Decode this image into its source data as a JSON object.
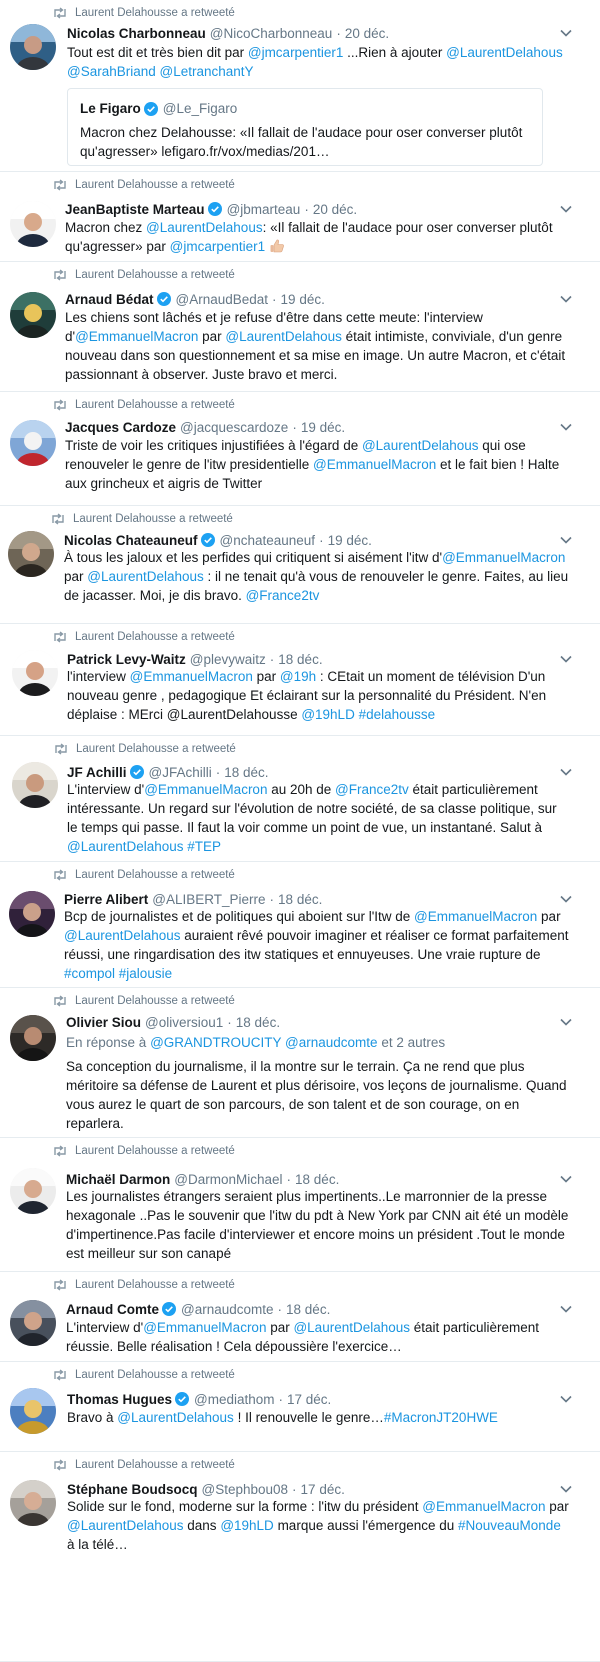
{
  "retweet_label": "Laurent Delahousse a retweeté",
  "colors": {
    "link": "#1b95e0",
    "muted": "#657786",
    "verified": "#1da1f2",
    "divider": "#e6ecf0"
  },
  "tweets": [
    {
      "name": "Nicolas Charbonneau",
      "verified": false,
      "handle": "@NicoCharbonneau",
      "date": "20 déc.",
      "segments": [
        [
          "t",
          "Tout est dit et très bien dit par "
        ],
        [
          "l",
          "@jmcarpentier1"
        ],
        [
          "t",
          " ...Rien à ajouter "
        ],
        [
          "l",
          "@LaurentDelahous"
        ],
        [
          "t",
          " "
        ],
        [
          "l",
          "@SarahBriand"
        ],
        [
          "t",
          " "
        ],
        [
          "l",
          "@LetranchantY"
        ]
      ],
      "quote": {
        "name": "Le Figaro",
        "handle": "@Le_Figaro",
        "text": "Macron chez Delahousse: «Il fallait de l'audace pour oser converser plutôt qu'agresser» lefigaro.fr/vox/medias/201…"
      }
    },
    {
      "name": "JeanBaptiste Marteau",
      "verified": true,
      "handle": "@jbmarteau",
      "date": "20 déc.",
      "segments": [
        [
          "t",
          "Macron chez "
        ],
        [
          "l",
          "@LaurentDelahous"
        ],
        [
          "t",
          ": «Il fallait de l'audace pour oser converser plutôt qu'agresser» par "
        ],
        [
          "l",
          "@jmcarpentier1"
        ],
        [
          "e",
          "thumbs-up-emoji"
        ]
      ]
    },
    {
      "name": "Arnaud Bédat",
      "verified": true,
      "handle": "@ArnaudBedat",
      "date": "19 déc.",
      "segments": [
        [
          "t",
          "Les chiens sont lâchés et je refuse d'être dans cette meute: l'interview d'"
        ],
        [
          "l",
          "@EmmanuelMacron"
        ],
        [
          "t",
          " par "
        ],
        [
          "l",
          "@LaurentDelahous"
        ],
        [
          "t",
          " était intimiste, conviviale, d'un genre nouveau dans son questionnement et sa mise en image. Un autre Macron, et c'était passionnant à observer. Juste bravo et merci."
        ]
      ]
    },
    {
      "name": "Jacques Cardoze",
      "verified": false,
      "handle": "@jacquescardoze",
      "date": "19 déc.",
      "segments": [
        [
          "t",
          "Triste de voir les critiques injustifiées à l'égard de "
        ],
        [
          "l",
          "@LaurentDelahous"
        ],
        [
          "t",
          " qui ose renouveler le genre de l'itw presidentielle "
        ],
        [
          "l",
          "@EmmanuelMacron"
        ],
        [
          "t",
          " et le fait bien ! Halte aux grincheux et aigris de Twitter"
        ]
      ]
    },
    {
      "name": "Nicolas Chateauneuf",
      "verified": true,
      "handle": "@nchateauneuf",
      "date": "19 déc.",
      "segments": [
        [
          "t",
          "À tous les jaloux et les perfides qui critiquent si aisément l'itw d'"
        ],
        [
          "l",
          "@EmmanuelMacron"
        ],
        [
          "t",
          " par "
        ],
        [
          "l",
          "@LaurentDelahous"
        ],
        [
          "t",
          " : il ne tenait qu'à vous de renouveler le genre. Faites, au lieu de jacasser. Moi, je dis bravo. "
        ],
        [
          "l",
          "@France2tv"
        ]
      ]
    },
    {
      "name": "Patrick Levy-Waitz",
      "verified": false,
      "handle": "@plevywaitz",
      "date": "18 déc.",
      "segments": [
        [
          "t",
          "l'interview "
        ],
        [
          "l",
          "@EmmanuelMacron"
        ],
        [
          "t",
          " par "
        ],
        [
          "l",
          "@19h"
        ],
        [
          "t",
          " : CEtait un moment de télévision D'un nouveau genre , pedagogique Et éclairant sur la personnalité du Président. N'en déplaise : MErci @LaurentDelahousse "
        ],
        [
          "l",
          "@19hLD"
        ],
        [
          "t",
          " "
        ],
        [
          "l",
          "#delahousse"
        ]
      ]
    },
    {
      "name": "JF Achilli",
      "verified": true,
      "handle": "@JFAchilli",
      "date": "18 déc.",
      "segments": [
        [
          "t",
          "L'interview d'"
        ],
        [
          "l",
          "@EmmanuelMacron"
        ],
        [
          "t",
          " au 20h de "
        ],
        [
          "l",
          "@France2tv"
        ],
        [
          "t",
          " était particulièrement intéressante. Un regard sur l'évolution de notre société, de sa classe politique, sur le temps qui passe. Il faut la voir comme un point de vue, un instantané. Salut à "
        ],
        [
          "l",
          "@LaurentDelahous"
        ],
        [
          "t",
          "  "
        ],
        [
          "l",
          "#TEP"
        ]
      ]
    },
    {
      "name": "Pierre Alibert",
      "verified": false,
      "handle": "@ALIBERT_Pierre",
      "date": "18 déc.",
      "segments": [
        [
          "t",
          "Bcp de journalistes et de politiques qui aboient sur l'Itw de "
        ],
        [
          "l",
          "@EmmanuelMacron"
        ],
        [
          "t",
          " par "
        ],
        [
          "l",
          "@LaurentDelahous"
        ],
        [
          "t",
          " auraient rêvé pouvoir imaginer et réaliser ce format parfaitement réussi, une ringardisation des itw statiques et ennuyeuses. Une vraie rupture de "
        ],
        [
          "l",
          "#compol"
        ],
        [
          "t",
          " "
        ],
        [
          "l",
          "#jalousie"
        ]
      ]
    },
    {
      "name": "Olivier Siou",
      "verified": false,
      "handle": "@oliversiou1",
      "date": "18 déc.",
      "reply": {
        "prefix": "En réponse à ",
        "a": "@GRANDTROUCITY",
        "b": "@arnaudcomte",
        "suffix": " et 2 autres"
      },
      "segments": [
        [
          "t",
          "Sa conception du journalisme, il la montre sur le terrain. Ça ne rend que plus méritoire sa défense de Laurent et plus dérisoire, vos leçons de journalisme. Quand vous aurez le quart de son parcours, de son talent et de son courage, on en reparlera."
        ]
      ]
    },
    {
      "name": "Michaël Darmon",
      "verified": false,
      "handle": "@DarmonMichael",
      "date": "18 déc.",
      "segments": [
        [
          "t",
          "Les journalistes étrangers seraient plus impertinents..Le marronnier de la presse hexagonale ..Pas le souvenir que l'itw du pdt à New York par CNN ait été un modèle d'impertinence.Pas facile d'interviewer et encore moins un président .Tout le monde est meilleur sur son canapé"
        ]
      ]
    },
    {
      "name": "Arnaud Comte",
      "verified": true,
      "handle": "@arnaudcomte",
      "date": "18 déc.",
      "segments": [
        [
          "t",
          "L'interview d'"
        ],
        [
          "l",
          "@EmmanuelMacron"
        ],
        [
          "t",
          " par "
        ],
        [
          "l",
          "@LaurentDelahous"
        ],
        [
          "t",
          " était particulièrement réussie. Belle réalisation ! Cela dépoussière l'exercice…"
        ]
      ]
    },
    {
      "name": "Thomas Hugues",
      "verified": true,
      "handle": "@mediathom",
      "date": "17 déc.",
      "segments": [
        [
          "t",
          "Bravo à "
        ],
        [
          "l",
          "@LaurentDelahous"
        ],
        [
          "t",
          " ! Il renouvelle le genre…"
        ],
        [
          "l",
          "#MacronJT20HWE"
        ]
      ]
    },
    {
      "name": "Stéphane Boudsocq",
      "verified": false,
      "handle": "@Stephbou08",
      "date": "17 déc.",
      "segments": [
        [
          "t",
          "Solide sur le fond, moderne sur la forme : l'itw du président "
        ],
        [
          "l",
          "@EmmanuelMacron"
        ],
        [
          "t",
          " par "
        ],
        [
          "l",
          "@LaurentDelahous"
        ],
        [
          "t",
          " dans "
        ],
        [
          "l",
          "@19hLD"
        ],
        [
          "t",
          " marque aussi l'émergence du "
        ],
        [
          "l",
          "#NouveauMonde"
        ],
        [
          "t",
          " à la télé…"
        ]
      ]
    }
  ]
}
